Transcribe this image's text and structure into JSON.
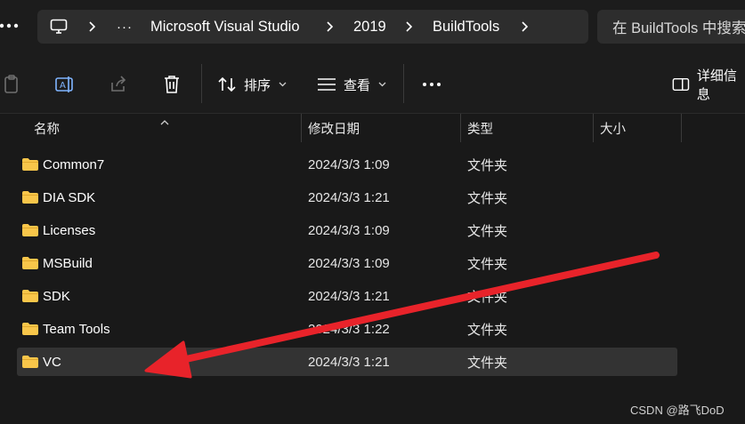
{
  "breadcrumb": {
    "items": [
      "Microsoft Visual Studio",
      "2019",
      "BuildTools"
    ],
    "overflow_label": "···"
  },
  "search": {
    "placeholder": "在 BuildTools 中搜索"
  },
  "toolbar": {
    "sort_label": "排序",
    "view_label": "查看",
    "more_label": "···",
    "details_label": "详细信息"
  },
  "columns": {
    "name": "名称",
    "date": "修改日期",
    "type": "类型",
    "size": "大小"
  },
  "files": [
    {
      "name": "Common7",
      "date": "2024/3/3 1:09",
      "type": "文件夹"
    },
    {
      "name": "DIA SDK",
      "date": "2024/3/3 1:21",
      "type": "文件夹"
    },
    {
      "name": "Licenses",
      "date": "2024/3/3 1:09",
      "type": "文件夹"
    },
    {
      "name": "MSBuild",
      "date": "2024/3/3 1:09",
      "type": "文件夹"
    },
    {
      "name": "SDK",
      "date": "2024/3/3 1:21",
      "type": "文件夹"
    },
    {
      "name": "Team Tools",
      "date": "2024/3/3 1:22",
      "type": "文件夹"
    },
    {
      "name": "VC",
      "date": "2024/3/3 1:21",
      "type": "文件夹",
      "selected": true
    }
  ],
  "watermark": "CSDN @路飞DoD",
  "colors": {
    "background": "#191919",
    "selection": "#333333",
    "folder": "#f8c64a",
    "annotation_arrow": "#e8232a"
  }
}
